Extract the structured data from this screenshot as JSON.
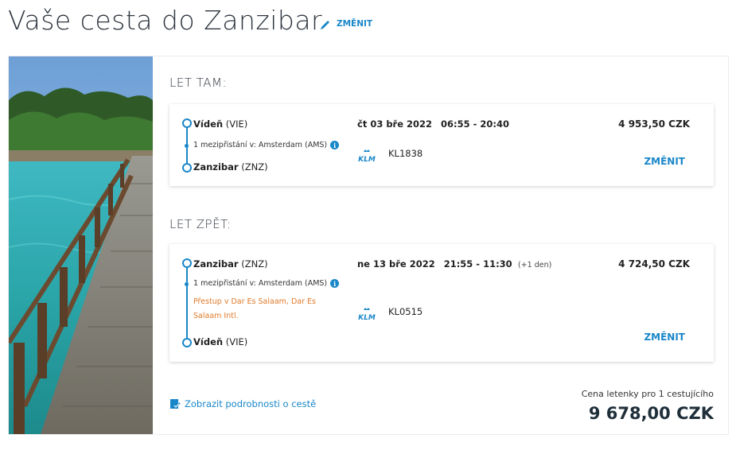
{
  "header": {
    "title": "Vaše cesta do Zanzibar",
    "edit_label": "ZMĚNIT"
  },
  "outbound": {
    "section_title": "LET TAM:",
    "from_city": "Vídeň",
    "from_code": "(VIE)",
    "stop_info": "1 mezipřistání v: Amsterdam (AMS)",
    "to_city": "Zanzibar",
    "to_code": "(ZNZ)",
    "date": "čt 03 bře 2022",
    "time": "06:55 - 20:40",
    "flight_no": "KL1838",
    "price": "4 953,50 CZK",
    "change_label": "ZMĚNIT"
  },
  "return": {
    "section_title": "LET ZPĚT:",
    "from_city": "Zanzibar",
    "from_code": "(ZNZ)",
    "stop_info": "1 mezipřistání v: Amsterdam (AMS)",
    "transfer": "Přestup v Dar Es Salaam, Dar Es Salaam Intl.",
    "to_city": "Vídeň",
    "to_code": "(VIE)",
    "date": "ne 13 bře 2022",
    "time": "21:55 - 11:30",
    "day_offset": "(+1 den)",
    "flight_no": "KL0515",
    "price": "4 724,50 CZK",
    "change_label": "ZMĚNIT"
  },
  "footer": {
    "details_link": "Zobrazit podrobnosti o cestě",
    "total_label": "Cena letenky pro 1 cestujícího",
    "total_value": "9 678,00 CZK"
  },
  "airline_logo": "KLM",
  "colors": {
    "accent": "#1a87c8",
    "transfer": "#e07a2a",
    "text": "#222222"
  }
}
